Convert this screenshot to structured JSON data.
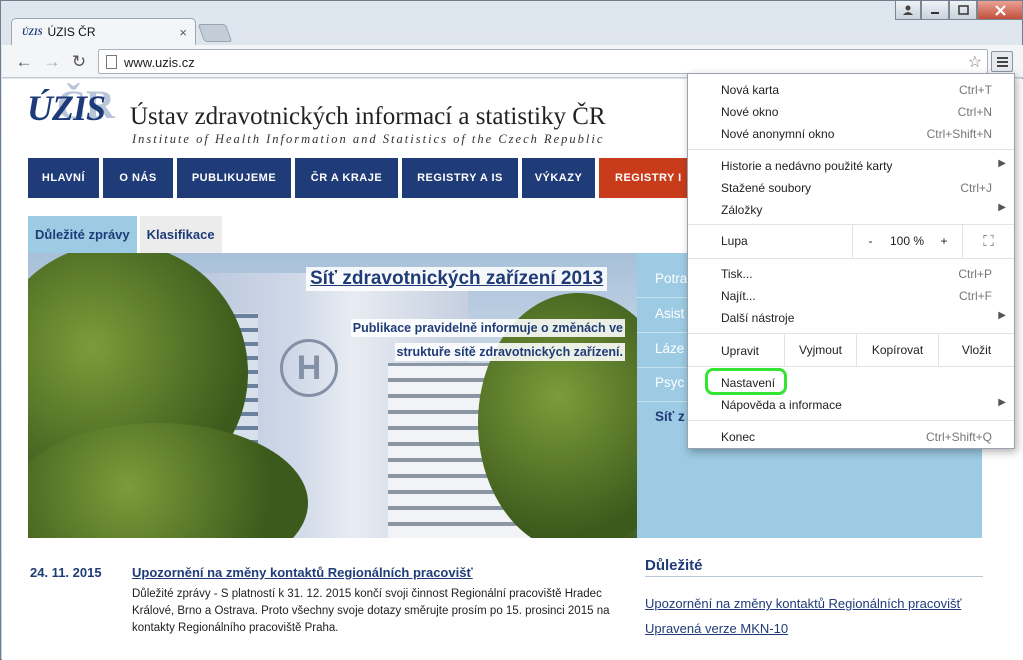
{
  "browser": {
    "tab_title": "ÚZIS ČR",
    "tab_favicon": "ÚZIS",
    "tab_close": "×",
    "url": "www.uzis.cz",
    "back_icon": "←",
    "forward_icon": "→",
    "reload_icon": "↻",
    "star_icon": "☆"
  },
  "site": {
    "logo": "ÚZIS",
    "logo_bg": "ČR",
    "title": "Ústav zdravotnických informací a statistiky ČR",
    "subtitle": "Institute of Health Information and Statistics of the Czech Republic",
    "nav": [
      "HLAVNÍ",
      "O NÁS",
      "PUBLIKUJEME",
      "ČR A KRAJE",
      "REGISTRY A IS",
      "VÝKAZY",
      "REGISTRY I"
    ],
    "subtabs": [
      "Důležité zprávy",
      "Klasifikace"
    ],
    "hero_title": "Síť zdravotnických zařízení 2013",
    "hero_text_1": "Publikace pravidelně informuje o změnách ve",
    "hero_text_2": "struktuře sítě zdravotnických zařízení.",
    "hero_helipad": "H",
    "side_items": [
      "Potra",
      "Asist",
      "Láze",
      "Psyc",
      "Síť z"
    ],
    "news": {
      "date": "24. 11. 2015",
      "title": "Upozornění na změny kontaktů Regionálních pracovišť",
      "body": "Důležité zprávy - S platností k 31. 12. 2015 končí svoji činnost Regionální pracoviště Hradec Králové, Brno a Ostrava. Proto všechny svoje dotazy směrujte prosím po 15. prosinci 2015 na kontakty Regionálního pracoviště Praha."
    },
    "important": {
      "heading": "Důležité",
      "links": [
        "Upozornění na změny kontaktů Regionálních pracovišť",
        "Upravená verze MKN-10"
      ]
    }
  },
  "menu": {
    "new_tab": {
      "label": "Nová karta",
      "shortcut": "Ctrl+T"
    },
    "new_window": {
      "label": "Nové okno",
      "shortcut": "Ctrl+N"
    },
    "incognito": {
      "label": "Nové anonymní okno",
      "shortcut": "Ctrl+Shift+N"
    },
    "history": {
      "label": "Historie a nedávno použité karty"
    },
    "downloads": {
      "label": "Stažené soubory",
      "shortcut": "Ctrl+J"
    },
    "bookmarks": {
      "label": "Záložky"
    },
    "zoom": {
      "label": "Lupa",
      "minus": "-",
      "value": "100 %",
      "plus": "+",
      "fullscreen": "⛶"
    },
    "print": {
      "label": "Tisk...",
      "shortcut": "Ctrl+P"
    },
    "find": {
      "label": "Najít...",
      "shortcut": "Ctrl+F"
    },
    "more_tools": {
      "label": "Další nástroje"
    },
    "edit": {
      "label": "Upravit",
      "cut": "Vyjmout",
      "copy": "Kopírovat",
      "paste": "Vložit"
    },
    "settings": {
      "label": "Nastavení"
    },
    "help": {
      "label": "Nápověda a informace"
    },
    "exit": {
      "label": "Konec",
      "shortcut": "Ctrl+Shift+Q"
    },
    "submenu_arrow": "▶"
  },
  "colors": {
    "nav_blue": "#1f3c78",
    "nav_red": "#c83c1c",
    "panel_blue": "#9ccbe3",
    "highlight_green": "#33e433"
  }
}
